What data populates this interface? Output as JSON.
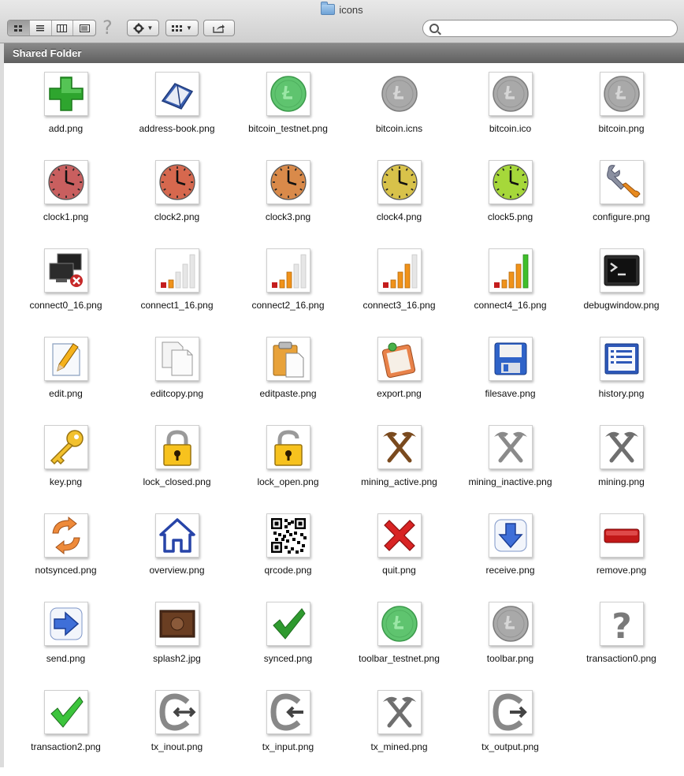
{
  "window": {
    "title": "icons"
  },
  "path_bar": {
    "title": "Shared Folder"
  },
  "search": {
    "placeholder": "",
    "value": ""
  },
  "toolbar": {
    "view_modes": [
      "icon-view",
      "list-view",
      "column-view",
      "cover-flow-view"
    ],
    "active_view": "icon-view"
  },
  "files": [
    {
      "name": "add.png",
      "icon": "plus-icon"
    },
    {
      "name": "address-book.png",
      "icon": "address-book-icon"
    },
    {
      "name": "bitcoin_testnet.png",
      "icon": "bitcoin-testnet-icon"
    },
    {
      "name": "bitcoin.icns",
      "icon": "bitcoin-icon"
    },
    {
      "name": "bitcoin.ico",
      "icon": "bitcoin-icon"
    },
    {
      "name": "bitcoin.png",
      "icon": "bitcoin-icon"
    },
    {
      "name": "clock1.png",
      "icon": "clock-icon",
      "color": "#c96060"
    },
    {
      "name": "clock2.png",
      "icon": "clock-icon",
      "color": "#d6684f"
    },
    {
      "name": "clock3.png",
      "icon": "clock-icon",
      "color": "#d98a4a"
    },
    {
      "name": "clock4.png",
      "icon": "clock-icon",
      "color": "#d8c24a"
    },
    {
      "name": "clock5.png",
      "icon": "clock-icon",
      "color": "#a6d83a"
    },
    {
      "name": "configure.png",
      "icon": "wrench-icon"
    },
    {
      "name": "connect0_16.png",
      "icon": "network-disconnected-icon"
    },
    {
      "name": "connect1_16.png",
      "icon": "signal-bars-icon",
      "level": 1
    },
    {
      "name": "connect2_16.png",
      "icon": "signal-bars-icon",
      "level": 2
    },
    {
      "name": "connect3_16.png",
      "icon": "signal-bars-icon",
      "level": 3
    },
    {
      "name": "connect4_16.png",
      "icon": "signal-bars-icon",
      "level": 4
    },
    {
      "name": "debugwindow.png",
      "icon": "terminal-icon"
    },
    {
      "name": "edit.png",
      "icon": "edit-icon"
    },
    {
      "name": "editcopy.png",
      "icon": "copy-icon"
    },
    {
      "name": "editpaste.png",
      "icon": "paste-icon"
    },
    {
      "name": "export.png",
      "icon": "export-icon"
    },
    {
      "name": "filesave.png",
      "icon": "floppy-icon"
    },
    {
      "name": "history.png",
      "icon": "history-list-icon"
    },
    {
      "name": "key.png",
      "icon": "key-icon"
    },
    {
      "name": "lock_closed.png",
      "icon": "lock-closed-icon"
    },
    {
      "name": "lock_open.png",
      "icon": "lock-open-icon"
    },
    {
      "name": "mining_active.png",
      "icon": "pickaxe-icon",
      "color": "#7a4a1e"
    },
    {
      "name": "mining_inactive.png",
      "icon": "pickaxe-icon",
      "color": "#8a8a8a"
    },
    {
      "name": "mining.png",
      "icon": "pickaxe-icon",
      "color": "#6f6f6f"
    },
    {
      "name": "notsynced.png",
      "icon": "sync-arrows-icon"
    },
    {
      "name": "overview.png",
      "icon": "home-icon"
    },
    {
      "name": "qrcode.png",
      "icon": "qr-code-icon"
    },
    {
      "name": "quit.png",
      "icon": "red-x-icon"
    },
    {
      "name": "receive.png",
      "icon": "receive-arrow-icon"
    },
    {
      "name": "remove.png",
      "icon": "remove-bar-icon"
    },
    {
      "name": "send.png",
      "icon": "send-arrow-icon"
    },
    {
      "name": "splash2.jpg",
      "icon": "splash-image-icon"
    },
    {
      "name": "synced.png",
      "icon": "checkmark-icon",
      "color": "#2f9a2f"
    },
    {
      "name": "toolbar_testnet.png",
      "icon": "bitcoin-testnet-icon"
    },
    {
      "name": "toolbar.png",
      "icon": "bitcoin-icon"
    },
    {
      "name": "transaction0.png",
      "icon": "question-mark-icon"
    },
    {
      "name": "transaction2.png",
      "icon": "checkmark-icon",
      "color": "#3cc43c"
    },
    {
      "name": "tx_inout.png",
      "icon": "tx-inout-icon"
    },
    {
      "name": "tx_input.png",
      "icon": "tx-input-icon"
    },
    {
      "name": "tx_mined.png",
      "icon": "pickaxe-icon",
      "color": "#6f6f6f"
    },
    {
      "name": "tx_output.png",
      "icon": "tx-output-icon"
    }
  ]
}
